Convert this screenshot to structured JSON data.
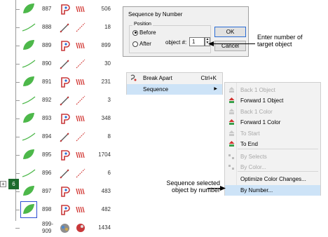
{
  "object_list": {
    "rows": [
      {
        "num": "887",
        "type": "fill",
        "stitch": "satin",
        "count": "506",
        "thumb": "leaf"
      },
      {
        "num": "888",
        "type": "run",
        "stitch": "run",
        "count": "18",
        "thumb": "line"
      },
      {
        "num": "889",
        "type": "fill",
        "stitch": "satin",
        "count": "899",
        "thumb": "leaf"
      },
      {
        "num": "890",
        "type": "run",
        "stitch": "run",
        "count": "30",
        "thumb": "line"
      },
      {
        "num": "891",
        "type": "fill",
        "stitch": "satin",
        "count": "231",
        "thumb": "leaf"
      },
      {
        "num": "892",
        "type": "run",
        "stitch": "run",
        "count": "3",
        "thumb": "line"
      },
      {
        "num": "893",
        "type": "fill",
        "stitch": "satin",
        "count": "348",
        "thumb": "leaf"
      },
      {
        "num": "894",
        "type": "run",
        "stitch": "run",
        "count": "8",
        "thumb": "line"
      },
      {
        "num": "895",
        "type": "fill",
        "stitch": "satin",
        "count": "1704",
        "thumb": "leaf"
      },
      {
        "num": "896",
        "type": "run",
        "stitch": "run",
        "count": "6",
        "thumb": "line"
      },
      {
        "num": "897",
        "type": "fill2",
        "stitch": "satin",
        "count": "483",
        "thumb": "leaf"
      },
      {
        "num": "898",
        "type": "fill2",
        "stitch": "satin",
        "count": "482",
        "thumb": "leaf"
      },
      {
        "num": "899-\n909",
        "type": "group",
        "stitch": "group",
        "count": "1434",
        "thumb": "none"
      }
    ],
    "group_badge": "6",
    "expand_glyph": "+"
  },
  "dialog": {
    "title": "Sequence by Number",
    "position_label": "Position",
    "before_label": "Before",
    "after_label": "After",
    "object_label": "object #:",
    "object_value": "1",
    "ok_label": "OK",
    "cancel_label": "Cancel"
  },
  "callouts": {
    "enter_number": "Enter number of\ntarget object",
    "sequence_selected": "Sequence selected\nobject by number"
  },
  "menu1": {
    "items": [
      {
        "label": "Break Apart",
        "shortcut": "Ctrl+K",
        "icon": "break-apart-icon"
      },
      {
        "label": "Sequence",
        "arrow": "▶",
        "icon": ""
      }
    ]
  },
  "menu2": {
    "items": [
      {
        "label": "Back 1 Object",
        "enabled": false
      },
      {
        "label": "Forward 1 Object",
        "enabled": true
      },
      {
        "label": "Back 1 Color",
        "enabled": false
      },
      {
        "label": "Forward 1 Color",
        "enabled": true
      },
      {
        "label": "To Start",
        "enabled": false
      },
      {
        "label": "To End",
        "enabled": true
      },
      {
        "label": "By Selects",
        "enabled": false
      },
      {
        "label": "By Color...",
        "enabled": false
      },
      {
        "label": "Optimize Color Changes...",
        "enabled": true
      },
      {
        "label": "By Number...",
        "enabled": true,
        "highlighted": true
      }
    ]
  },
  "colors": {
    "leaf_green": "#4db84a",
    "selection_blue": "#2d4fd3",
    "satin_red": "#d0312d",
    "menu_highlight": "#cde3f7",
    "group_badge": "#1d6b2e"
  }
}
